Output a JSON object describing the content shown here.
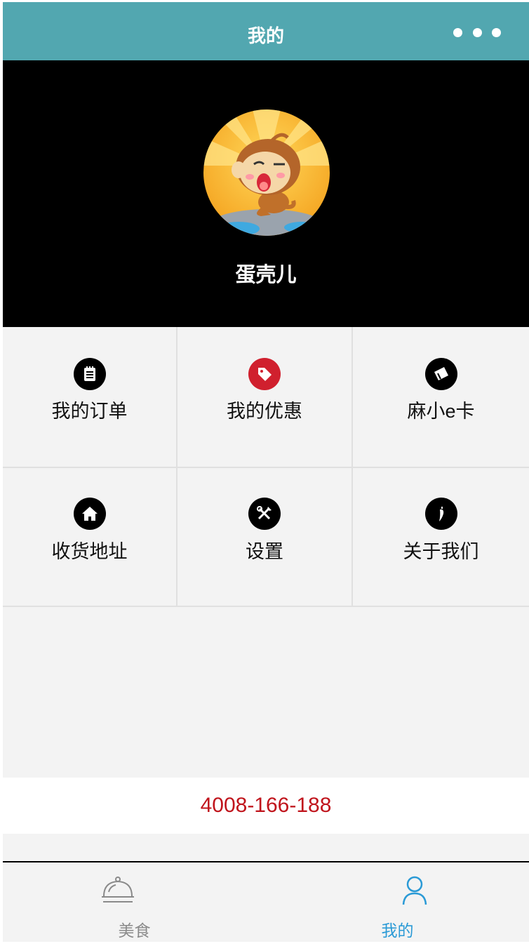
{
  "navbar": {
    "title": "我的",
    "more_icon": "more-dots-icon",
    "background_color": "#52a7b0"
  },
  "profile": {
    "avatar_icon": "monkey-avatar",
    "username": "蛋壳儿"
  },
  "menu": {
    "items": [
      {
        "label": "我的订单",
        "icon": "order-list-icon"
      },
      {
        "label": "我的优惠",
        "icon": "price-tag-icon",
        "icon_color": "#d0202e"
      },
      {
        "label": "麻小e卡",
        "icon": "card-icon"
      },
      {
        "label": "收货地址",
        "icon": "home-icon"
      },
      {
        "label": "设置",
        "icon": "tools-icon"
      },
      {
        "label": "关于我们",
        "icon": "pepper-icon"
      }
    ]
  },
  "contact": {
    "phone": "4008-166-188",
    "color": "#c0141c"
  },
  "tabbar": {
    "tabs": [
      {
        "label": "美食",
        "icon": "food-cloche-icon",
        "active": false
      },
      {
        "label": "我的",
        "icon": "user-icon",
        "active": true,
        "active_color": "#2a9ad6"
      }
    ]
  }
}
